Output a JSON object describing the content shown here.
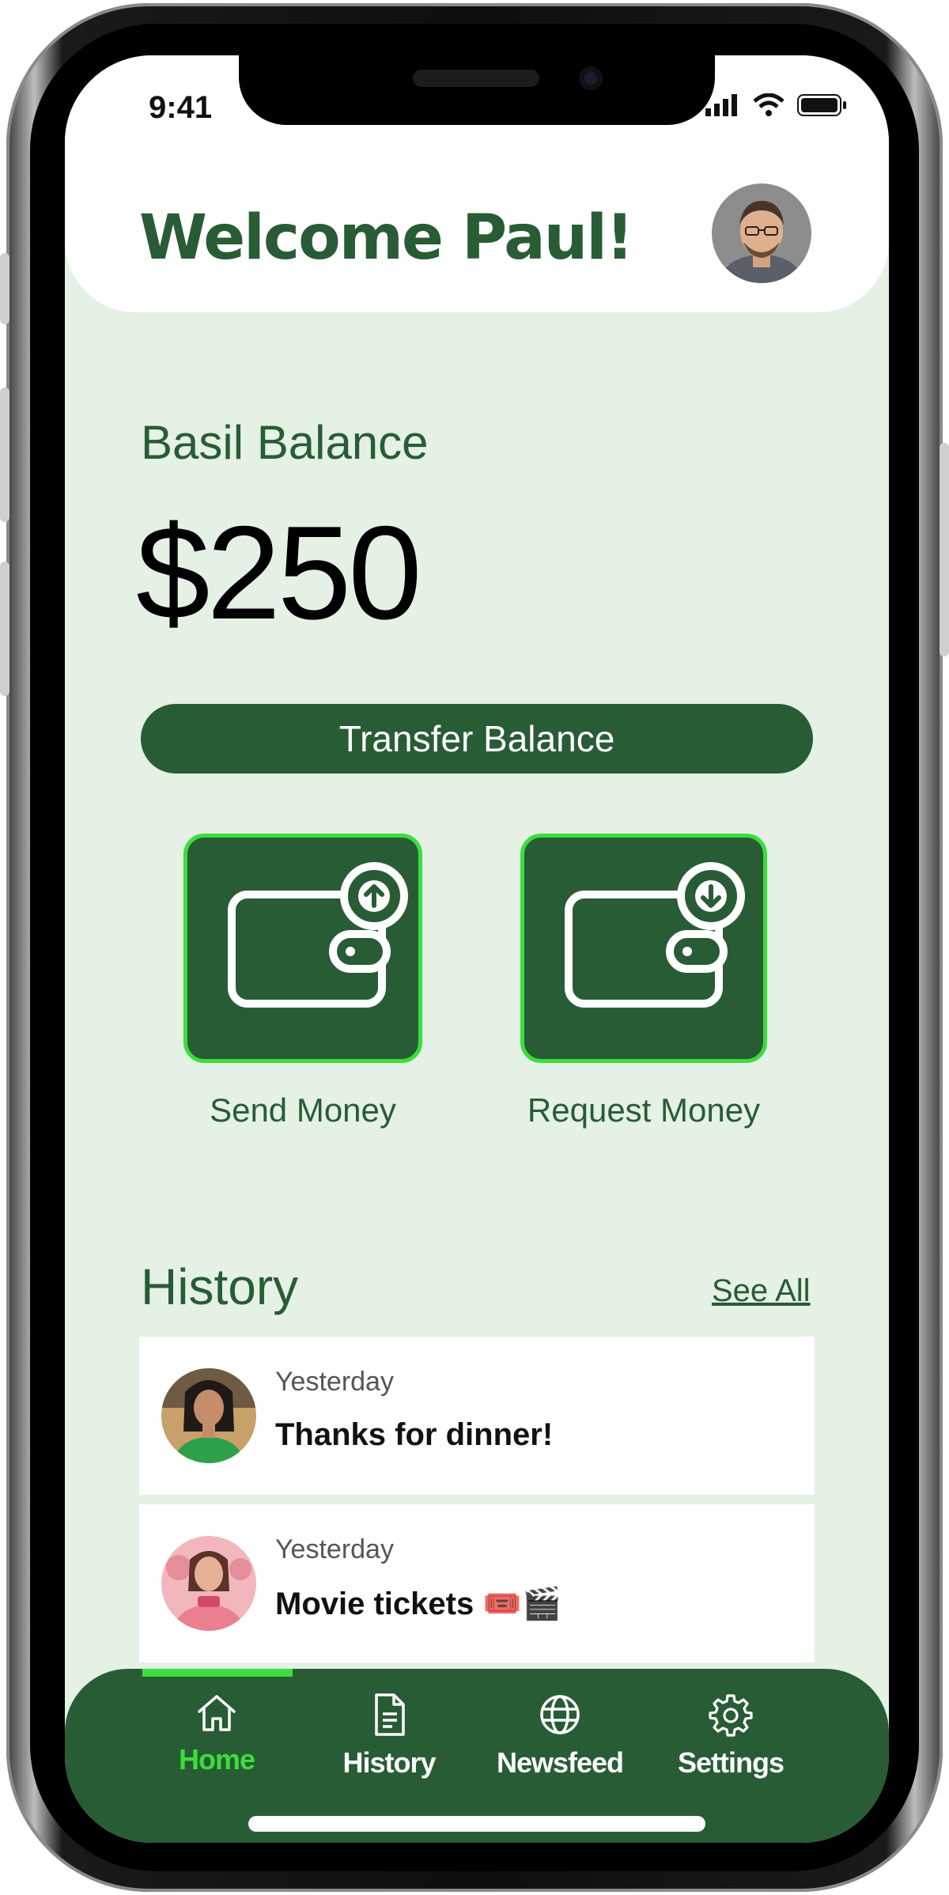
{
  "status": {
    "time": "9:41"
  },
  "header": {
    "greeting": "Welcome Paul!"
  },
  "balance": {
    "label": "Basil Balance",
    "amount": "$250"
  },
  "transfer": {
    "label": "Transfer Balance"
  },
  "actions": [
    {
      "label": "Send Money",
      "icon": "wallet-send-icon"
    },
    {
      "label": "Request Money",
      "icon": "wallet-request-icon"
    }
  ],
  "history": {
    "title": "History",
    "see_all": "See All",
    "items": [
      {
        "date": "Yesterday",
        "text": "Thanks for dinner!"
      },
      {
        "date": "Yesterday",
        "text": "Movie tickets 🎟️🎬"
      }
    ]
  },
  "nav": {
    "items": [
      {
        "label": "Home",
        "icon": "home-icon",
        "active": true
      },
      {
        "label": "History",
        "icon": "document-icon",
        "active": false
      },
      {
        "label": "Newsfeed",
        "icon": "globe-icon",
        "active": false
      },
      {
        "label": "Settings",
        "icon": "gear-icon",
        "active": false
      }
    ]
  },
  "colors": {
    "brand": "#285c35",
    "accent": "#3bde3b",
    "background": "#e4f1e4"
  }
}
